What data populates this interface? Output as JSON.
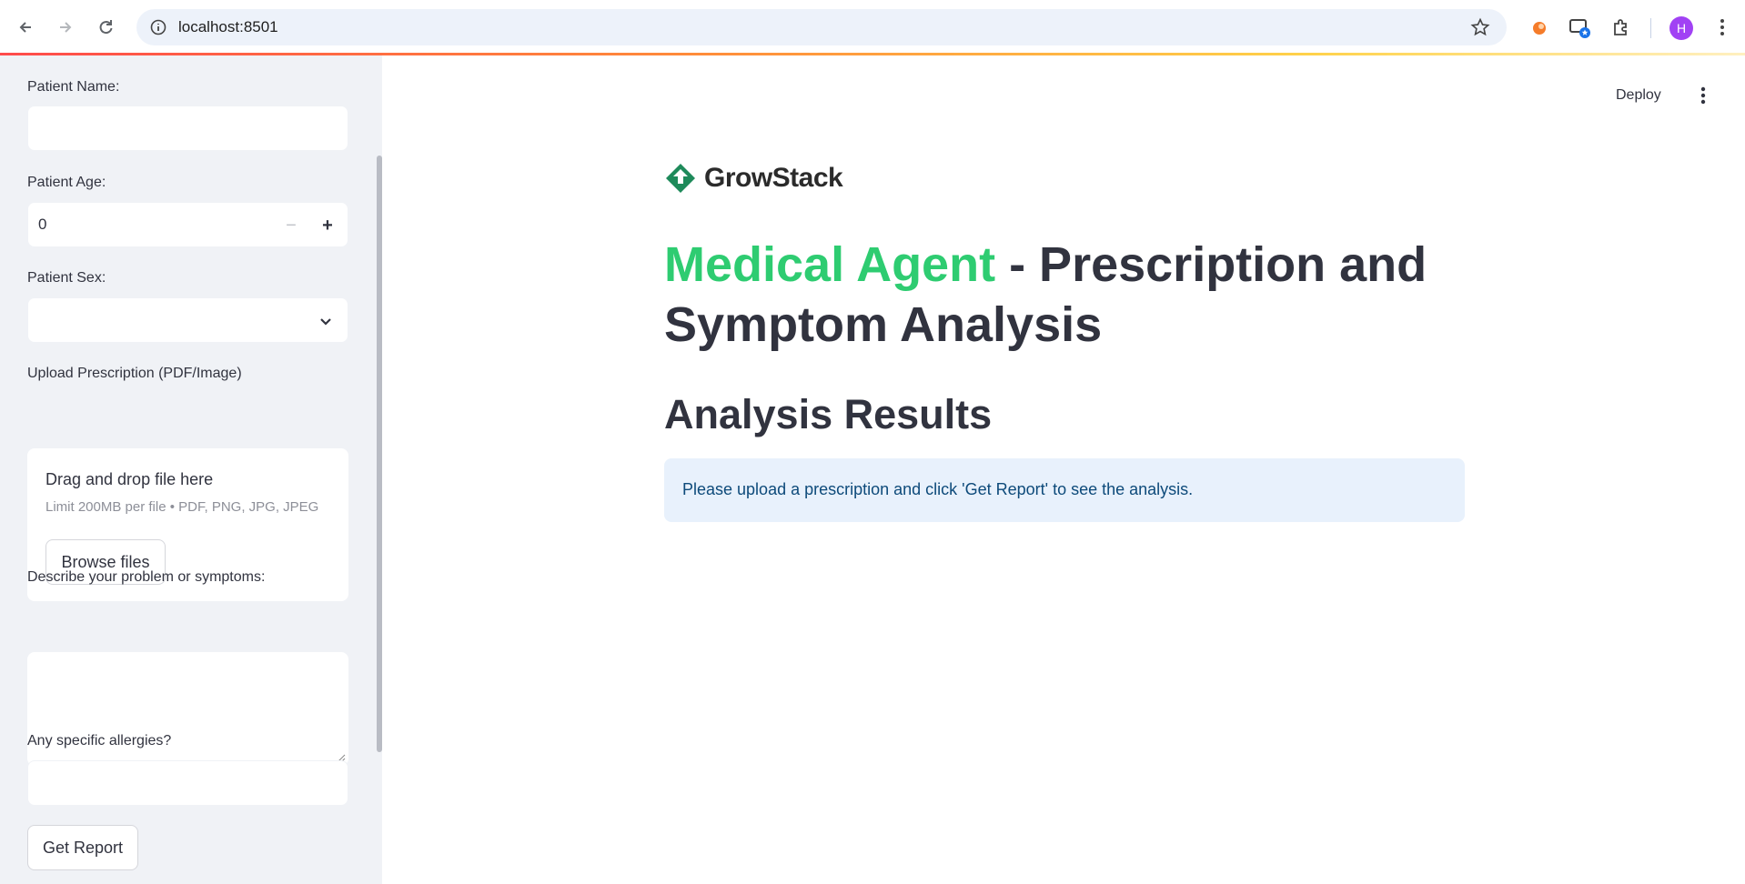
{
  "browser": {
    "url": "localhost:8501",
    "avatar_letter": "H"
  },
  "sidebar": {
    "patient_name_label": "Patient Name:",
    "patient_name_value": "",
    "patient_age_label": "Patient Age:",
    "patient_age_value": "0",
    "patient_sex_label": "Patient Sex:",
    "patient_sex_value": "",
    "upload_label": "Upload Prescription (PDF/Image)",
    "upload_title": "Drag and drop file here",
    "upload_limit": "Limit 200MB per file • PDF, PNG, JPG, JPEG",
    "browse_label": "Browse files",
    "symptoms_label": "Describe your problem or symptoms:",
    "symptoms_value": "",
    "allergies_label": "Any specific allergies?",
    "allergies_value": "",
    "get_report_label": "Get Report"
  },
  "header": {
    "deploy_label": "Deploy"
  },
  "main": {
    "logo_text": "GrowStack",
    "title_accent": "Medical Agent",
    "title_rest": " - Prescription and Symptom Analysis",
    "section_title": "Analysis Results",
    "info_message": "Please upload a prescription and click 'Get Report' to see the analysis."
  },
  "colors": {
    "accent_green": "#2ecc71",
    "info_bg": "#e8f1fc",
    "info_text": "#0d4a7a",
    "sidebar_bg": "#f0f2f6"
  }
}
